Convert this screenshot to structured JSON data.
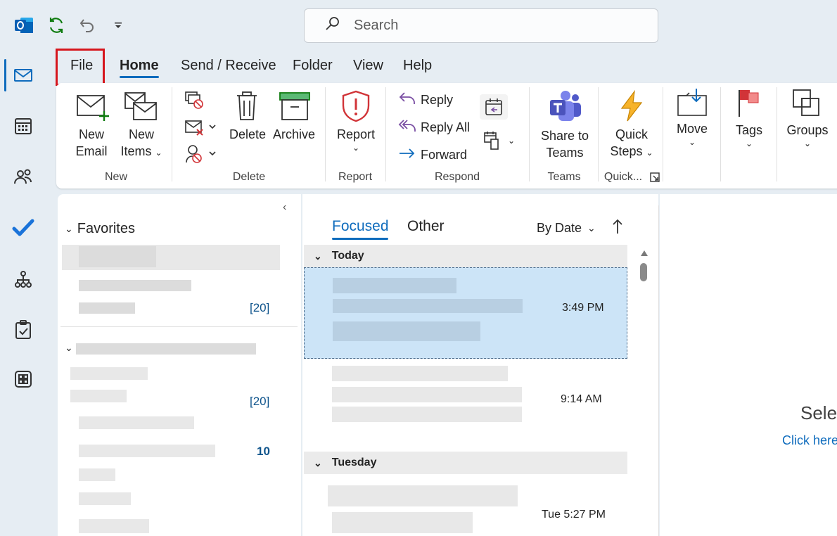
{
  "search": {
    "placeholder": "Search"
  },
  "menu": {
    "tabs": [
      "File",
      "Home",
      "Send / Receive",
      "Folder",
      "View",
      "Help"
    ]
  },
  "ribbon": {
    "new_email": [
      "New",
      "Email"
    ],
    "new_items": [
      "New",
      "Items"
    ],
    "group_new": "New",
    "delete": "Delete",
    "archive": "Archive",
    "group_delete": "Delete",
    "report": "Report",
    "group_report": "Report",
    "reply": "Reply",
    "reply_all": "Reply All",
    "forward": "Forward",
    "group_respond": "Respond",
    "share_to_teams": [
      "Share to",
      "Teams"
    ],
    "group_teams": "Teams",
    "quick_steps": [
      "Quick",
      "Steps"
    ],
    "group_quick": "Quick...",
    "move": "Move",
    "tags": "Tags",
    "groups": "Groups"
  },
  "folders": {
    "favorites_label": "Favorites",
    "counts": [
      "[20]",
      "[20]",
      "10"
    ]
  },
  "messages": {
    "tab_focused": "Focused",
    "tab_other": "Other",
    "sort_label": "By Date",
    "group_today": "Today",
    "group_tuesday": "Tuesday",
    "times": [
      "3:49 PM",
      "9:14 AM",
      "Tue 5:27 PM"
    ]
  },
  "reading": {
    "select_text": "Sele",
    "click_here": "Click here"
  },
  "colors": {
    "accent": "#0f6cbd",
    "file_highlight": "#d6161d",
    "selected_message": "#cce4f7"
  }
}
